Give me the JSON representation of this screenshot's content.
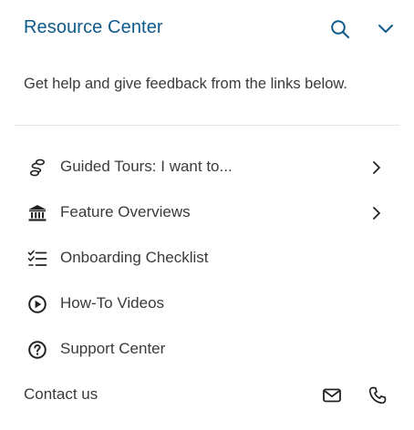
{
  "header": {
    "title": "Resource Center",
    "search_icon": "search-icon",
    "collapse_icon": "chevron-down-icon"
  },
  "subtitle": "Get help and give feedback from the links below.",
  "menu": {
    "items": [
      {
        "label": "Guided Tours: I want to...",
        "icon": "route-icon",
        "has_submenu": true
      },
      {
        "label": "Feature Overviews",
        "icon": "bank-icon",
        "has_submenu": true
      },
      {
        "label": "Onboarding Checklist",
        "icon": "checklist-icon",
        "has_submenu": false
      },
      {
        "label": "How-To Videos",
        "icon": "play-circle-icon",
        "has_submenu": false
      },
      {
        "label": "Support Center",
        "icon": "question-circle-icon",
        "has_submenu": false
      }
    ]
  },
  "contact": {
    "label": "Contact us",
    "email_icon": "mail-icon",
    "phone_icon": "phone-icon"
  },
  "colors": {
    "accent": "#0e5a8a",
    "text": "#3a3a3a",
    "divider": "#e3e3e3",
    "icon": "#222222"
  }
}
